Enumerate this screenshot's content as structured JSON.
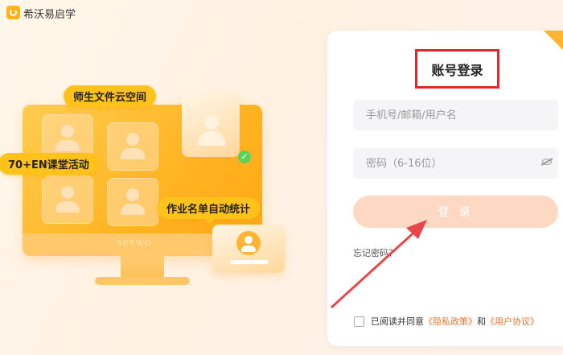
{
  "app": {
    "title": "希沃易启学"
  },
  "illustration": {
    "bubbles": [
      "师生文件云空间",
      "70+EN课堂活动",
      "作业名单自动统计"
    ],
    "brand_text": "seewo"
  },
  "login": {
    "title": "账号登录",
    "username_placeholder": "手机号/邮箱/用户名",
    "password_placeholder": "密码（6-16位）",
    "login_button": "登 录",
    "forgot_password": "忘记密码？",
    "agreement": {
      "prefix": "已阅读并同意",
      "privacy": "《隐私政策》",
      "and": "和",
      "user_agreement": "《用户协议》"
    }
  },
  "colors": {
    "accent": "#ffb531",
    "annotation": "#e3262b",
    "link": "#f0752a"
  },
  "icons": {
    "app_logo": "app-logo-icon",
    "check": "check-icon",
    "eye": "eye-icon",
    "corner": "qr-switch-icon"
  }
}
